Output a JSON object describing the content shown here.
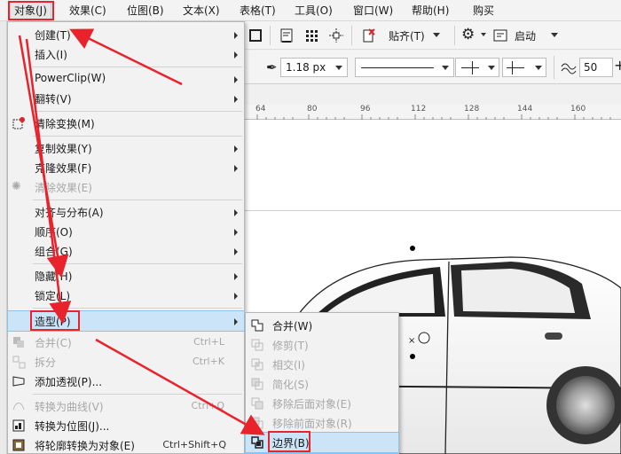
{
  "menubar": {
    "items": [
      "对象(J)",
      "效果(C)",
      "位图(B)",
      "文本(X)",
      "表格(T)",
      "工具(O)",
      "窗口(W)",
      "帮助(H)",
      "购买"
    ]
  },
  "toolbar": {
    "align_label": "贴齐(T)",
    "launch_label": "启动",
    "line_width": "1.18 px",
    "smooth_value": "50"
  },
  "ruler": {
    "ticks": [
      "64",
      "80",
      "96",
      "112",
      "128",
      "144",
      "160"
    ]
  },
  "object_menu": {
    "items": [
      {
        "label": "创建(T)",
        "submenu": true
      },
      {
        "label": "插入(I)",
        "submenu": true
      },
      {
        "label": "PowerClip(W)",
        "submenu": true
      },
      {
        "label": "翻转(V)",
        "submenu": true
      },
      {
        "label": "清除变换(M)"
      },
      {
        "label": "复制效果(Y)",
        "submenu": true
      },
      {
        "label": "克隆效果(F)",
        "submenu": true
      },
      {
        "label": "清除效果(E)",
        "disabled": true
      },
      {
        "label": "对齐与分布(A)",
        "submenu": true
      },
      {
        "label": "顺序(O)",
        "submenu": true
      },
      {
        "label": "组合(G)",
        "submenu": true
      },
      {
        "label": "隐藏(H)",
        "submenu": true
      },
      {
        "label": "锁定(L)",
        "submenu": true
      },
      {
        "label": "造型(P)",
        "submenu": true,
        "highlighted": true
      },
      {
        "label": "合并(C)",
        "shortcut": "Ctrl+L",
        "disabled": true
      },
      {
        "label": "拆分",
        "shortcut": "Ctrl+K",
        "disabled": true
      },
      {
        "label": "添加透视(P)..."
      },
      {
        "label": "转换为曲线(V)",
        "shortcut": "Ctrl+Q",
        "disabled": true
      },
      {
        "label": "转换为位图(J)..."
      },
      {
        "label": "将轮廓转换为对象(E)",
        "shortcut": "Ctrl+Shift+Q"
      }
    ]
  },
  "shaping_submenu": {
    "items": [
      {
        "label": "合并(W)"
      },
      {
        "label": "修剪(T)",
        "disabled": true
      },
      {
        "label": "相交(I)",
        "disabled": true
      },
      {
        "label": "简化(S)",
        "disabled": true
      },
      {
        "label": "移除后面对象(E)",
        "disabled": true
      },
      {
        "label": "移除前面对象(R)",
        "disabled": true
      },
      {
        "label": "边界(B)",
        "highlighted": true
      }
    ]
  },
  "colors": {
    "annotation_red": "#e8232c",
    "highlight": "#cce4f7"
  }
}
